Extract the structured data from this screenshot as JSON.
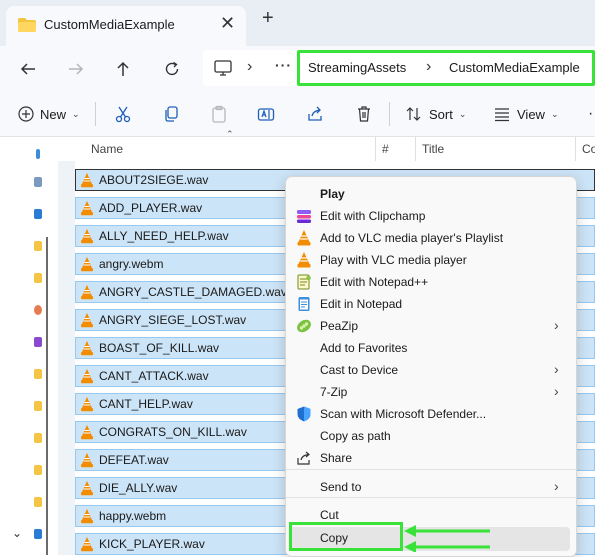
{
  "tab": {
    "title": "CustomMediaExample",
    "close_icon": "close-icon",
    "new_tab_icon": "plus-icon"
  },
  "address": {
    "crumbs": [
      "StreamingAssets",
      "CustomMediaExample"
    ],
    "more": "···"
  },
  "toolbar": {
    "new_label": "New",
    "sort_label": "Sort",
    "view_label": "View"
  },
  "columns": {
    "name": "Name",
    "number": "#",
    "title": "Title",
    "contrib": "Co"
  },
  "files": [
    {
      "name": "ABOUT2SIEGE.wav"
    },
    {
      "name": "ADD_PLAYER.wav"
    },
    {
      "name": "ALLY_NEED_HELP.wav"
    },
    {
      "name": "angry.webm"
    },
    {
      "name": "ANGRY_CASTLE_DAMAGED.wav"
    },
    {
      "name": "ANGRY_SIEGE_LOST.wav"
    },
    {
      "name": "BOAST_OF_KILL.wav"
    },
    {
      "name": "CANT_ATTACK.wav"
    },
    {
      "name": "CANT_HELP.wav"
    },
    {
      "name": "CONGRATS_ON_KILL.wav"
    },
    {
      "name": "DEFEAT.wav"
    },
    {
      "name": "DIE_ALLY.wav"
    },
    {
      "name": "happy.webm"
    },
    {
      "name": "KICK_PLAYER.wav"
    }
  ],
  "context_menu": {
    "items": [
      {
        "label": "Play",
        "icon": "none",
        "bold": true
      },
      {
        "label": "Edit with Clipchamp",
        "icon": "clipchamp-icon"
      },
      {
        "label": "Add to VLC media player's Playlist",
        "icon": "vlc-icon"
      },
      {
        "label": "Play with VLC media player",
        "icon": "vlc-icon"
      },
      {
        "label": "Edit with Notepad++",
        "icon": "notepadpp-icon"
      },
      {
        "label": "Edit in Notepad",
        "icon": "notepad-icon"
      },
      {
        "label": "PeaZip",
        "icon": "peazip-icon",
        "submenu": true
      },
      {
        "label": "Add to Favorites",
        "icon": "none"
      },
      {
        "label": "Cast to Device",
        "icon": "none",
        "submenu": true
      },
      {
        "label": "7-Zip",
        "icon": "none",
        "submenu": true
      },
      {
        "label": "Scan with Microsoft Defender...",
        "icon": "defender-icon"
      },
      {
        "label": "Copy as path",
        "icon": "none"
      },
      {
        "label": "Share",
        "icon": "share-icon"
      },
      {
        "label": "Send to",
        "icon": "none",
        "submenu": true
      },
      {
        "label": "Cut",
        "icon": "none"
      },
      {
        "label": "Copy",
        "icon": "none",
        "highlighted": true
      }
    ]
  },
  "colors": {
    "highlight_green": "#39e239",
    "selection": "#cce4f7",
    "vlc_orange": "#f28c00"
  }
}
